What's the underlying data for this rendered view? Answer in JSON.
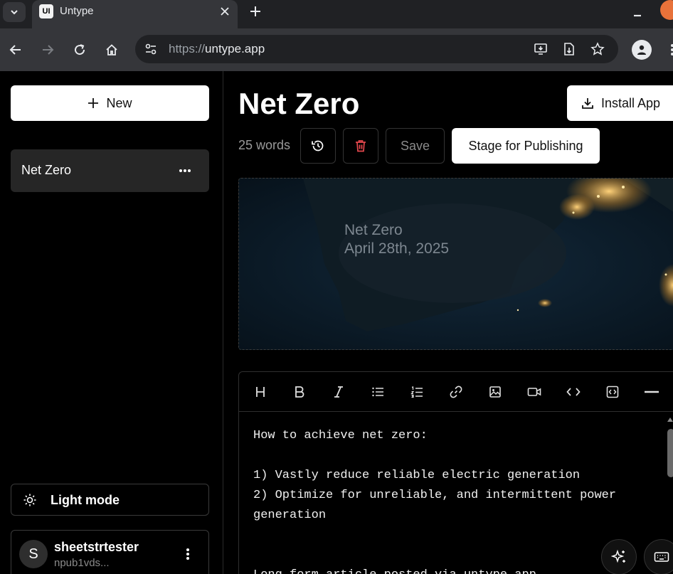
{
  "browser": {
    "tab_title": "Untype",
    "favicon_text": "UI",
    "url_scheme": "https://",
    "url_host": "untype.app"
  },
  "sidebar": {
    "new_label": "New",
    "documents": [
      {
        "label": "Net Zero"
      }
    ],
    "light_mode_label": "Light mode",
    "user": {
      "avatar_initial": "S",
      "name": "sheetstrtester",
      "npub": "npub1vds..."
    }
  },
  "main": {
    "title": "Net Zero",
    "install_label": "Install App",
    "word_count": "25 words",
    "save_label": "Save",
    "stage_label": "Stage for Publishing",
    "cover": {
      "title": "Net Zero",
      "date": "April 28th, 2025"
    },
    "editor": {
      "toolbar": [
        "heading-icon",
        "bold-icon",
        "italic-icon",
        "bullet-list-icon",
        "numbered-list-icon",
        "link-icon",
        "image-icon",
        "video-icon",
        "code-icon",
        "code-block-icon",
        "horizontal-rule-icon"
      ],
      "lines": [
        "How to achieve net zero:",
        "",
        "1) Vastly reduce reliable electric generation",
        "2) Optimize for unreliable, and intermittent power generation",
        "",
        "",
        "Long form article posted via untype.app"
      ]
    }
  },
  "colors": {
    "background": "#000000",
    "browser_frame": "#35363a",
    "tab_strip": "#202124",
    "primary_button": "#ffffff",
    "danger_icon": "#e5484d",
    "selected_item": "#262626"
  }
}
